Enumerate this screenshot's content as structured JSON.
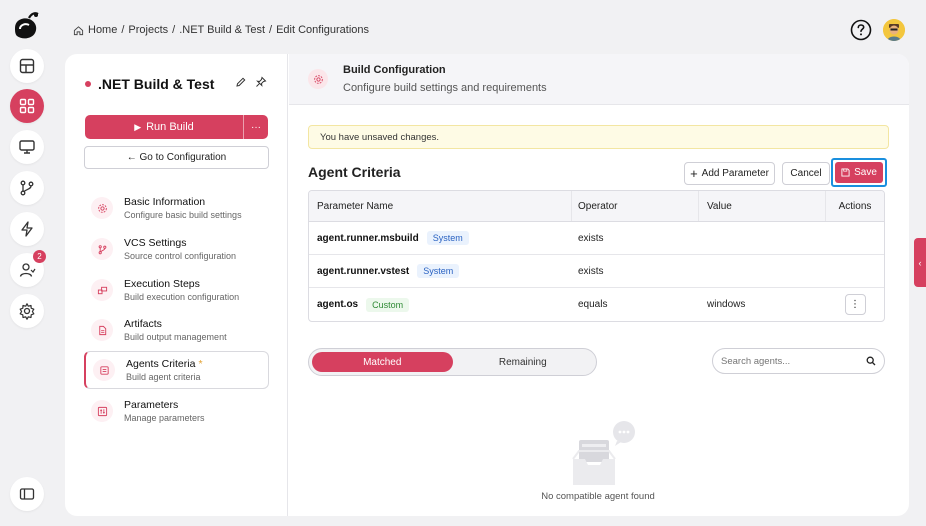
{
  "breadcrumb": {
    "items": [
      "Home",
      "Projects",
      ".NET Build & Test",
      "Edit Configurations"
    ],
    "separator": "/"
  },
  "rail": {
    "items": [
      "logo-icon",
      "dashboard-icon",
      "apps-icon",
      "monitor-icon",
      "branch-icon",
      "lightning-icon",
      "users-icon",
      "gear-icon"
    ],
    "active_index": 2,
    "users_badge": "2"
  },
  "project": {
    "title": ".NET Build & Test",
    "run_label": "Run Build",
    "more_label": "···",
    "goto_label": "← Go to Configuration"
  },
  "nav": [
    {
      "title": "Basic Information",
      "subtitle": "Configure basic build settings",
      "icon": "gear-icon"
    },
    {
      "title": "VCS Settings",
      "subtitle": "Source control configuration",
      "icon": "branch-icon"
    },
    {
      "title": "Execution Steps",
      "subtitle": "Build execution configuration",
      "icon": "steps-icon"
    },
    {
      "title": "Artifacts",
      "subtitle": "Build output management",
      "icon": "file-icon"
    },
    {
      "title": "Agents Criteria",
      "subtitle": "Build agent criteria",
      "icon": "agent-icon",
      "active": true,
      "modified_marker": "*"
    },
    {
      "title": "Parameters",
      "subtitle": "Manage parameters",
      "icon": "params-icon"
    }
  ],
  "header": {
    "title": "Build Configuration",
    "subtitle": "Configure build settings and requirements"
  },
  "warning": "You have unsaved changes.",
  "section": {
    "title": "Agent Criteria",
    "add_label": "Add Parameter",
    "cancel_label": "Cancel",
    "save_label": "Save"
  },
  "table": {
    "columns": [
      "Parameter Name",
      "Operator",
      "Value",
      "Actions"
    ],
    "rows": [
      {
        "name": "agent.runner.msbuild",
        "tag": "System",
        "operator": "exists",
        "value": ""
      },
      {
        "name": "agent.runner.vstest",
        "tag": "System",
        "operator": "exists",
        "value": ""
      },
      {
        "name": "agent.os",
        "tag": "Custom",
        "operator": "equals",
        "value": "windows",
        "actions": "⋮"
      }
    ]
  },
  "tabs": {
    "matched_label": "Matched",
    "remaining_label": "Remaining"
  },
  "search": {
    "placeholder": "Search agents..."
  },
  "empty_text": "No compatible agent found",
  "colors": {
    "accent": "#d6405f",
    "focus_ring": "#1a8fde",
    "warning_bg": "#fefbe5"
  }
}
